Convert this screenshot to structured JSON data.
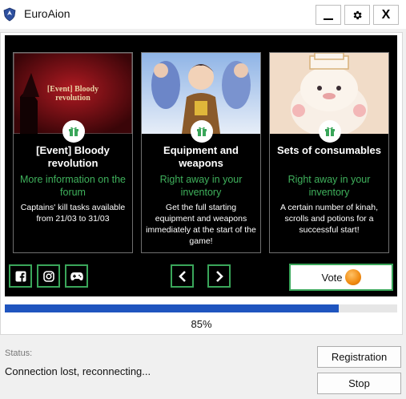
{
  "window": {
    "title": "EuroAion",
    "logo_icon": "shield-logo-icon",
    "controls": [
      "minimize-icon",
      "gear-icon",
      "close-icon"
    ],
    "close_label": "X"
  },
  "cards": [
    {
      "image_caption": "[Event] Bloody revolution",
      "title": "[Event] Bloody revolution",
      "subtitle": "More information on the forum",
      "description": "Captains' kill tasks available from 21/03 to 31/03"
    },
    {
      "title": "Equipment and weapons",
      "subtitle": "Right away in your inventory",
      "description": "Get the full starting equipment and weapons immediately at the start of the game!"
    },
    {
      "title": "Sets of consumables",
      "subtitle": "Right away in your inventory",
      "description": "A certain number of kinah, scrolls and potions for a successful start!"
    }
  ],
  "social": [
    "facebook-icon",
    "instagram-icon",
    "gamepad-icon"
  ],
  "nav": [
    "chevron-left-icon",
    "chevron-right-icon"
  ],
  "vote": {
    "label": "Vote"
  },
  "progress": {
    "value": 85,
    "label": "85%"
  },
  "status": {
    "label": "Status:",
    "text": "Connection lost, reconnecting..."
  },
  "buttons": {
    "registration": "Registration",
    "stop": "Stop"
  },
  "colors": {
    "accent_green": "#3aa65a",
    "subtitle_green": "#3fb15c",
    "progress_blue": "#1f55bf",
    "banner_bg": "#000000"
  }
}
